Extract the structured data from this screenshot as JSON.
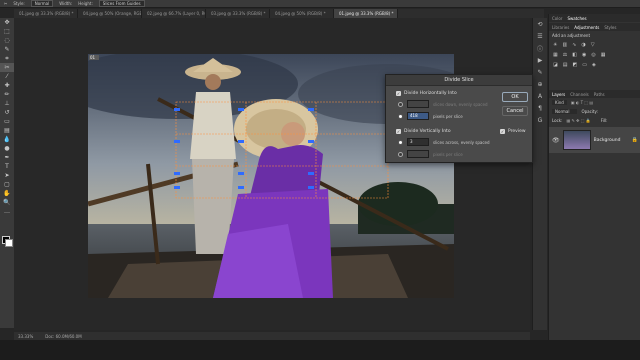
{
  "options_bar": {
    "style_label": "Style:",
    "style_value": "Normal",
    "width_label": "Width:",
    "height_label": "Height:",
    "slices_from_guides": "Slices From Guides"
  },
  "tabs": [
    {
      "label": "01.jpeg @ 33.3% (RGB/8) *"
    },
    {
      "label": "04.jpeg @ 50% (Orange, RGB/8) *"
    },
    {
      "label": "02.jpeg @ 66.7% (Layer 0, RGB/8) *"
    },
    {
      "label": "03.jpeg @ 33.3% (RGB/8) *"
    },
    {
      "label": "04.jpeg @ 50% (RGB/8) *"
    },
    {
      "label": "01.jpeg @ 33.3% (RGB/8) *"
    }
  ],
  "active_tab": 5,
  "slice_badge": "01",
  "status": {
    "zoom": "33.33%",
    "doc": "Doc: 60.0M/60.0M"
  },
  "dialog": {
    "title": "Divide Slice",
    "horiz_label": "Divide Horizontally Into",
    "horiz_opt1_text": "slices down, evenly spaced",
    "horiz_opt2_value": "418",
    "horiz_opt2_text": "pixels per slice",
    "vert_label": "Divide Vertically Into",
    "vert_opt1_value": "3",
    "vert_opt1_text": "slices across, evenly spaced",
    "vert_opt2_text": "pixels per slice",
    "ok_label": "OK",
    "cancel_label": "Cancel",
    "preview_label": "Preview"
  },
  "panels": {
    "top_tabs": [
      "Color",
      "Swatches"
    ],
    "mid_tabs": [
      "Libraries",
      "Adjustments",
      "Styles"
    ],
    "adjust_hint": "Add an adjustment",
    "layer_tabs": [
      "Layers",
      "Channels",
      "Paths"
    ],
    "kind_label": "Kind",
    "blend_mode": "Normal",
    "opacity_label": "Opacity:",
    "lock_label": "Lock:",
    "fill_label": "Fill:",
    "layer_name": "Background"
  }
}
